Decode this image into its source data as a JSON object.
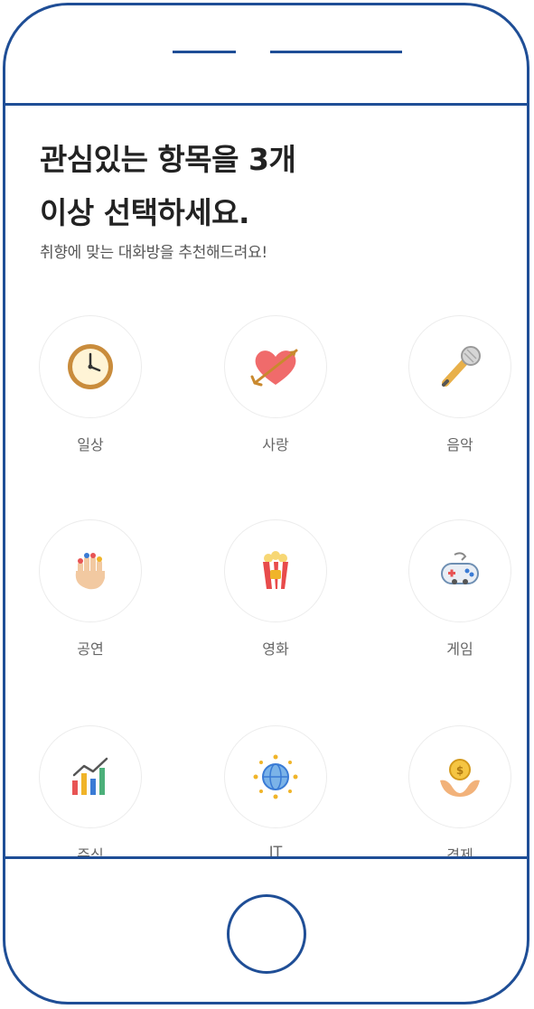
{
  "header": {
    "title_line1": "관심있는 항목을 3개",
    "title_line2": "이상 선택하세요.",
    "subtitle": "취향에 맞는 대화방을 추천해드려요!"
  },
  "categories": [
    {
      "label": "일상",
      "icon": "clock-icon"
    },
    {
      "label": "사랑",
      "icon": "heart-arrow-icon"
    },
    {
      "label": "음악",
      "icon": "microphone-icon"
    },
    {
      "label": "공연",
      "icon": "hand-icon"
    },
    {
      "label": "영화",
      "icon": "popcorn-icon"
    },
    {
      "label": "게임",
      "icon": "gamepad-icon"
    },
    {
      "label": "주식",
      "icon": "chart-icon"
    },
    {
      "label": "IT",
      "icon": "globe-network-icon"
    },
    {
      "label": "경제",
      "icon": "coin-hands-icon"
    }
  ],
  "colors": {
    "frame": "#1f4e96",
    "title_text": "#222222",
    "subtitle_text": "#555555",
    "label_text": "#666666"
  }
}
